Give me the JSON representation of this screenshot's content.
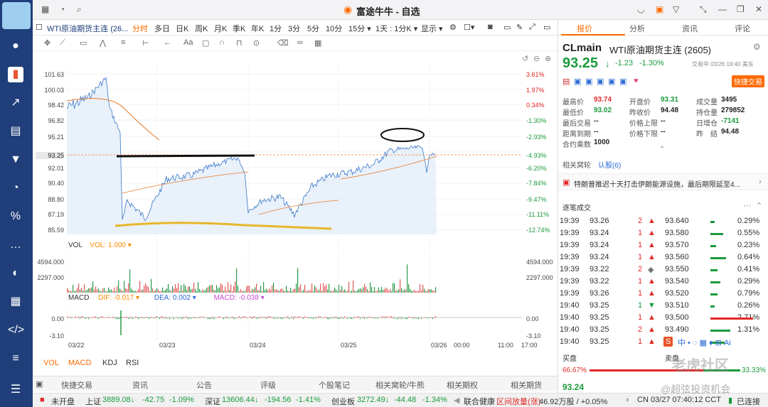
{
  "app": {
    "title": "富途牛牛 - 自选"
  },
  "chart_tabs": {
    "symbol": "WTI原油期货主连 (26...",
    "items": [
      "分时",
      "多日",
      "日K",
      "周K",
      "月K",
      "季K",
      "年K",
      "1分",
      "3分",
      "5分",
      "10分",
      "15分 ▾",
      "1天 : 1分K ▾",
      "显示 ▾"
    ]
  },
  "chart": {
    "left_axis": [
      "101.63",
      "100.03",
      "98.42",
      "96.82",
      "95.21",
      "93.25",
      "92.01",
      "90.40",
      "88.80",
      "87.19",
      "85.59"
    ],
    "right_axis": [
      "3.61%",
      "1.97%",
      "0.34%",
      "-1.30%",
      "-2.93%",
      "-4.93%",
      "-6.20%",
      "-7.84%",
      "-9.47%",
      "-11.11%",
      "-12.74%"
    ],
    "vol_label": "VOL",
    "vol_value": "VOL: 1.000 ▾",
    "vol_axis": [
      "4594.000",
      "2297.000"
    ],
    "macd_label": "MACD",
    "dif": "DIF: -0.017 ▾",
    "dea": "DEA: 0.002 ▾",
    "macd": "MACD: -0.038 ▾",
    "macd_axis": [
      "0.00",
      "-3.10"
    ],
    "x_labels": [
      "03/22",
      "03/23",
      "03/24",
      "03/25",
      "03/26",
      "00:00",
      "11:00",
      "17:00"
    ],
    "indicators": [
      "VOL",
      "MACD",
      "KDJ",
      "RSI"
    ]
  },
  "bottom_tabs": [
    "快捷交易",
    "资讯",
    "公告",
    "评级",
    "个股笔记",
    "相关窝轮/牛熊",
    "相关期权",
    "相关期货"
  ],
  "status": {
    "market_state": "未开盘",
    "sh_label": "上证",
    "sh_val": "3889.08↓",
    "sh_chg": "-42.75",
    "sh_pct": "-1.09%",
    "sz_label": "深证",
    "sz_val": "13606.44↓",
    "sz_chg": "-194.56",
    "sz_pct": "-1.41%",
    "cy_label": "创业板",
    "cy_val": "3272.49↓",
    "cy_chg": "-44.48",
    "cy_pct": "-1.34%",
    "health": "联合健康",
    "health_note": "区间放量(涨)",
    "health_vol": "46.92万股 / +0.05%",
    "time": "CN 03/27 07:40:12 CCT",
    "conn": "已连接"
  },
  "quote": {
    "tabs": [
      "报价",
      "分析",
      "资讯",
      "评论"
    ],
    "code": "CLmain",
    "name": "WTI原油期货主连 (2605)",
    "price": "93.25",
    "chg": "-1.23",
    "pct": "-1.30%",
    "trade_time": "交易中 03/26 19:40 美东",
    "quick_trade": "快捷交易",
    "fields": [
      [
        "最高价",
        "93.74",
        "开盘价",
        "93.31",
        "成交量",
        "3495"
      ],
      [
        "最低价",
        "93.02",
        "昨收价",
        "94.48",
        "持仓量",
        "279852"
      ],
      [
        "最后交易",
        "--",
        "价格上限",
        "--",
        "日增仓",
        "-7141"
      ],
      [
        "距离到期",
        "--",
        "价格下限",
        "--",
        "昨　结",
        "94.48"
      ],
      [
        "合约乘数",
        "1000",
        "",
        "",
        "",
        ""
      ]
    ],
    "related": "相关窝轮",
    "options": "认股(6)",
    "news": "特朗普推迟十天打击伊朗能源设施，最后期限延至4...",
    "ticks_title": "逐笔成交",
    "ticks": [
      [
        "19:39",
        "93.26",
        "2",
        "▲",
        "93.640",
        "0.29%"
      ],
      [
        "19:39",
        "93.24",
        "1",
        "▲",
        "93.580",
        "0.55%"
      ],
      [
        "19:39",
        "93.24",
        "1",
        "▲",
        "93.570",
        "0.23%"
      ],
      [
        "19:39",
        "93.24",
        "1",
        "▲",
        "93.560",
        "0.64%"
      ],
      [
        "19:39",
        "93.22",
        "2",
        "◆",
        "93.550",
        "0.41%"
      ],
      [
        "19:39",
        "93.22",
        "1",
        "▲",
        "93.540",
        "0.29%"
      ],
      [
        "19:39",
        "93.26",
        "1",
        "▲",
        "93.520",
        "0.79%"
      ],
      [
        "19:40",
        "93.25",
        "1",
        "▼",
        "93.510",
        "0.26%"
      ],
      [
        "19:40",
        "93.25",
        "1",
        "▲",
        "93.500",
        "2.71%"
      ],
      [
        "19:40",
        "93.25",
        "2",
        "▲",
        "93.490",
        "1.31%"
      ],
      [
        "19:40",
        "93.25",
        "1",
        "▲",
        "",
        ""
      ]
    ],
    "buy_label": "买盘",
    "sell_label": "卖盘",
    "buy_pct": "66.67%",
    "sell_pct": "33.33%",
    "bottom_price": "93.24",
    "watermark": "老虎社区",
    "watermark2": "@超弦投资机会"
  },
  "colors": {
    "up": "#e12929",
    "down": "#1a9a3c",
    "nav": "#1f3e7a",
    "accent": "#ff6a00"
  }
}
